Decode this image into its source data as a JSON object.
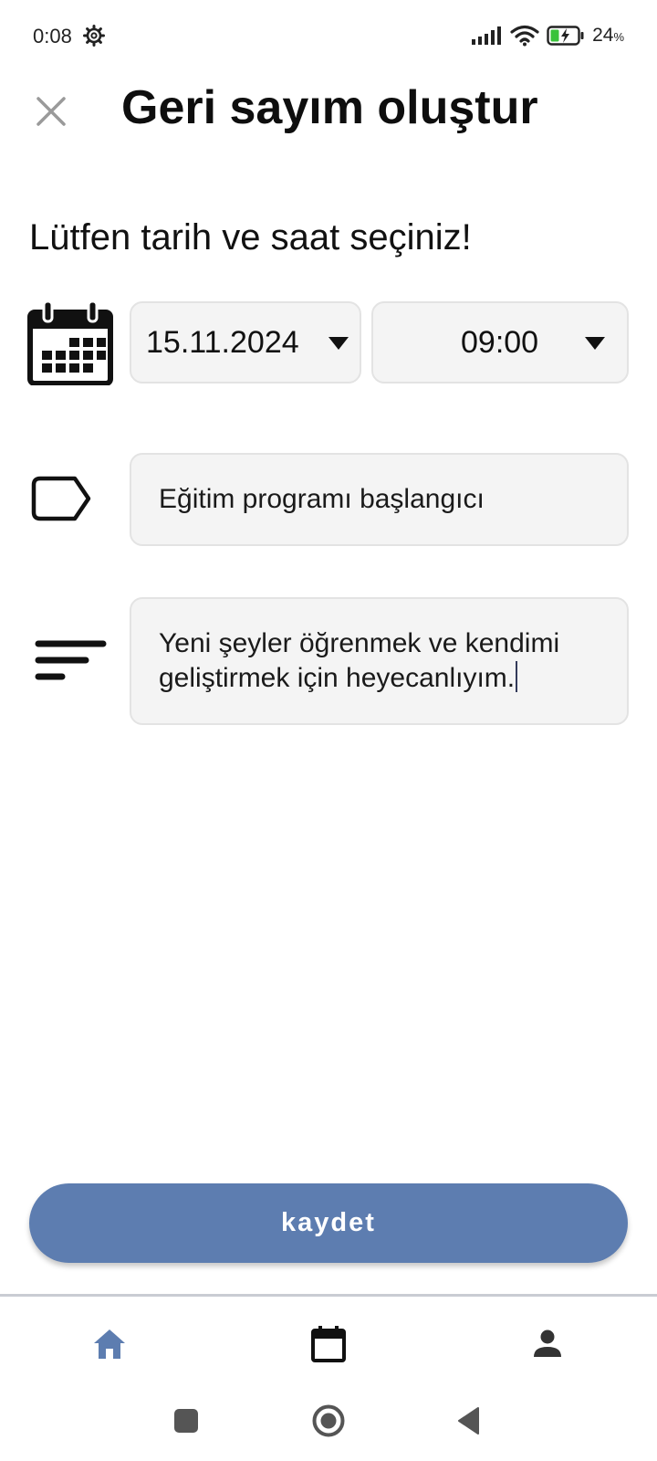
{
  "status_bar": {
    "time": "0:08",
    "battery_percent": "24",
    "battery_unit": "%",
    "icons": [
      "settings-gear-icon",
      "signal-icon",
      "wifi-icon",
      "battery-charging-icon"
    ]
  },
  "header": {
    "close_icon": "close-icon",
    "title": "Geri sayım oluştur"
  },
  "form": {
    "prompt": "Lütfen tarih ve saat seçiniz!",
    "date": {
      "value": "15.11.2024",
      "icon": "calendar-icon"
    },
    "time": {
      "value": "09:00"
    },
    "title_field": {
      "value": "Eğitim programı başlangıcı",
      "icon": "tag-icon"
    },
    "description_field": {
      "line1": "Yeni şeyler öğrenmek ve kendimi",
      "line2": "geliştirmek için heyecanlıyım.",
      "icon": "description-lines-icon"
    }
  },
  "save_button": {
    "label": "kaydet"
  },
  "bottom_nav": {
    "items": [
      {
        "icon": "home-icon",
        "active": true
      },
      {
        "icon": "calendar-icon",
        "active": false
      },
      {
        "icon": "profile-icon",
        "active": false
      }
    ]
  },
  "system_nav": {
    "buttons": [
      "recent-apps-icon",
      "home-circle-icon",
      "back-triangle-icon"
    ]
  },
  "colors": {
    "accent": "#5d7db0",
    "field_bg": "#f4f4f4",
    "field_border": "#e3e3e3",
    "text": "#111111"
  }
}
